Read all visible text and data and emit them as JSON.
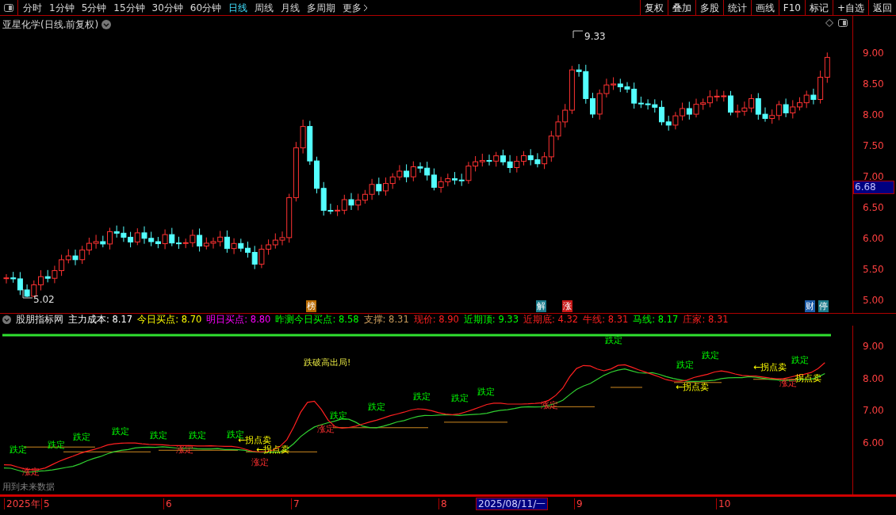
{
  "toolbar": {
    "periods": [
      {
        "label": "分时",
        "selected": false
      },
      {
        "label": "1分钟",
        "selected": false
      },
      {
        "label": "5分钟",
        "selected": false
      },
      {
        "label": "15分钟",
        "selected": false
      },
      {
        "label": "30分钟",
        "selected": false
      },
      {
        "label": "60分钟",
        "selected": false
      },
      {
        "label": "日线",
        "selected": true
      },
      {
        "label": "周线",
        "selected": false
      },
      {
        "label": "月线",
        "selected": false
      },
      {
        "label": "多周期",
        "selected": false
      },
      {
        "label": "更多",
        "selected": false
      }
    ],
    "buttons": [
      "复权",
      "叠加",
      "多股",
      "统计",
      "画线",
      "F10",
      "标记",
      "+自选",
      "返回"
    ]
  },
  "price_chart": {
    "title": "亚星化学(日线.前复权)",
    "high_label": "9.33",
    "low_label": "5.02",
    "y_axis": [
      "9.00",
      "8.50",
      "8.00",
      "7.50",
      "7.00",
      "6.50",
      "6.00",
      "5.50",
      "5.00"
    ],
    "current_price": "6.68",
    "event_markers": [
      {
        "label": "榜",
        "color": "#b86a00"
      },
      {
        "label": "解",
        "color": "#1c7c8c"
      },
      {
        "label": "涨",
        "color": "#c81818"
      },
      {
        "label": "财",
        "color": "#1c5ca8"
      },
      {
        "label": "停",
        "color": "#1c7c8c"
      }
    ]
  },
  "indicator": {
    "name": "股朋指标网",
    "readouts": [
      {
        "label": "主力成本:",
        "value": "8.17",
        "color": "#ffffff"
      },
      {
        "label": "今日买点:",
        "value": "8.70",
        "color": "#ffff00"
      },
      {
        "label": "明日买点:",
        "value": "8.80",
        "color": "#ff00ff"
      },
      {
        "label": "昨测今日买点:",
        "value": "8.58",
        "color": "#00ff00"
      },
      {
        "label": "支撑:",
        "value": "8.31",
        "color": "#c89a5a"
      },
      {
        "label": "现价:",
        "value": "8.90",
        "color": "#ff2020"
      },
      {
        "label": "近期顶:",
        "value": "9.33",
        "color": "#00ff00"
      },
      {
        "label": "近期底:",
        "value": "4.32",
        "color": "#ff2020"
      },
      {
        "label": "牛线:",
        "value": "8.31",
        "color": "#ff2020"
      },
      {
        "label": "马线:",
        "value": "8.17",
        "color": "#00ff00"
      },
      {
        "label": "庄家:",
        "value": "8.31",
        "color": "#ff2020"
      }
    ],
    "y_axis": [
      "9.00",
      "8.00",
      "7.00",
      "6.00"
    ],
    "signals": [
      {
        "text": "跌定",
        "kind": "ding"
      },
      {
        "text": "跌定",
        "kind": "ding"
      },
      {
        "text": "跌定",
        "kind": "ding"
      },
      {
        "text": "跌定",
        "kind": "ding"
      },
      {
        "text": "跌定",
        "kind": "ding"
      },
      {
        "text": "跌定",
        "kind": "ding"
      },
      {
        "text": "跌定",
        "kind": "ding"
      },
      {
        "text": "跌定",
        "kind": "ding"
      },
      {
        "text": "跌定",
        "kind": "ding"
      },
      {
        "text": "跌定",
        "kind": "ding"
      },
      {
        "text": "跌定",
        "kind": "ding"
      },
      {
        "text": "跌定",
        "kind": "ding"
      },
      {
        "text": "跌定",
        "kind": "ding"
      },
      {
        "text": "跌定",
        "kind": "ding"
      },
      {
        "text": "跌定",
        "kind": "ding"
      },
      {
        "text": "跌定",
        "kind": "ding"
      },
      {
        "text": "跌破高出局!",
        "kind": "exit"
      },
      {
        "text": "←拐点卖",
        "kind": "sell"
      },
      {
        "text": "←拐点卖",
        "kind": "sell"
      },
      {
        "text": "←拐点卖",
        "kind": "sell"
      },
      {
        "text": "←拐点卖",
        "kind": "sell"
      },
      {
        "text": "拐点卖",
        "kind": "sell"
      },
      {
        "text": "涨定",
        "kind": "zhang"
      },
      {
        "text": "涨定",
        "kind": "zhang"
      },
      {
        "text": "涨定",
        "kind": "zhang"
      },
      {
        "text": "涨定",
        "kind": "zhang"
      },
      {
        "text": "涨定",
        "kind": "zhang"
      },
      {
        "text": "涨定",
        "kind": "zhang"
      }
    ],
    "note": "用到未来数据"
  },
  "date_axis": {
    "labels": [
      "2025年",
      "5",
      "6",
      "7",
      "8",
      "9",
      "10"
    ],
    "cursor_date": "2025/08/11/一"
  }
}
